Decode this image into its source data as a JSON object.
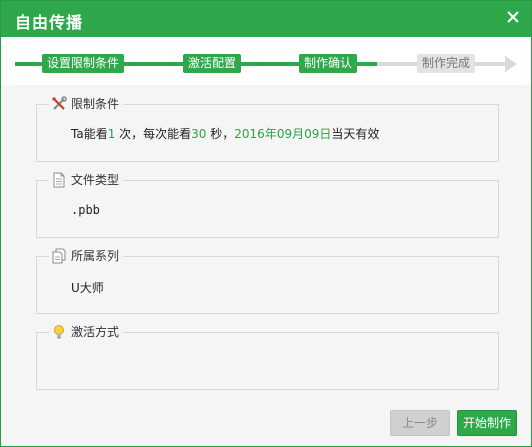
{
  "window": {
    "title": "自由传播"
  },
  "steps": [
    {
      "label": "设置限制条件",
      "state": "done"
    },
    {
      "label": "激活配置",
      "state": "done"
    },
    {
      "label": "制作确认",
      "state": "current"
    },
    {
      "label": "制作完成",
      "state": "pending"
    }
  ],
  "restrictions": {
    "title": "限制条件",
    "text_prefix": "Ta能看",
    "view_count": "1",
    "text_mid1": " 次，每次能看",
    "seconds": "30",
    "text_mid2": " 秒，",
    "date": "2016年09月09日",
    "text_suffix": "当天有效"
  },
  "file_type": {
    "title": "文件类型",
    "value": ".pbb"
  },
  "series": {
    "title": "所属系列",
    "value": "U大师"
  },
  "activation": {
    "title": "激活方式",
    "value": ""
  },
  "buttons": {
    "prev": "上一步",
    "start": "开始制作"
  },
  "colors": {
    "accent": "#2ea84a",
    "highlight_text": "#2e9f46",
    "inactive": "#d9d9d9"
  }
}
